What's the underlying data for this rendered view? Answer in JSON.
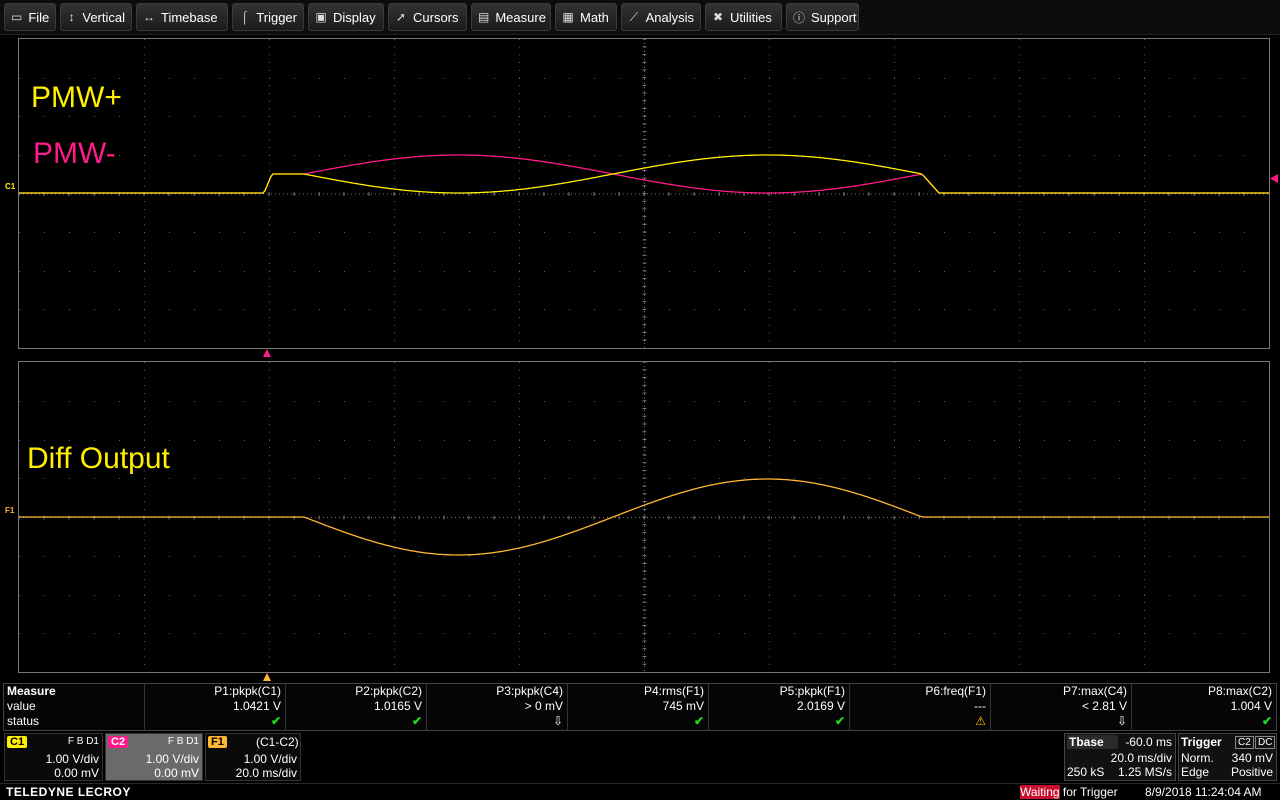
{
  "menu": [
    {
      "label": "File",
      "icon": "file-icon"
    },
    {
      "label": "Vertical",
      "icon": "vertical-arrows-icon"
    },
    {
      "label": "Timebase",
      "icon": "horizontal-arrows-icon"
    },
    {
      "label": "Trigger",
      "icon": "trigger-icon"
    },
    {
      "label": "Display",
      "icon": "display-icon"
    },
    {
      "label": "Cursors",
      "icon": "cursor-icon"
    },
    {
      "label": "Measure",
      "icon": "measure-icon"
    },
    {
      "label": "Math",
      "icon": "calculator-icon"
    },
    {
      "label": "Analysis",
      "icon": "chart-icon"
    },
    {
      "label": "Utilities",
      "icon": "tools-icon"
    },
    {
      "label": "Support",
      "icon": "info-icon"
    }
  ],
  "labels": {
    "pmw_plus": "PMW+",
    "pmw_minus": "PMW-",
    "diff": "Diff Output",
    "c1_marker": "C1",
    "f1_marker": "F1"
  },
  "colors": {
    "c1": "#ffef00",
    "c2": "#ff1a8c",
    "f1": "#ffb833",
    "grid": "#777777"
  },
  "measure": {
    "header": "Measure",
    "row_value": "value",
    "row_status": "status",
    "params": [
      {
        "name": "P1:pkpk(C1)",
        "value": "1.0421 V",
        "status": "✔"
      },
      {
        "name": "P2:pkpk(C2)",
        "value": "1.0165 V",
        "status": "✔"
      },
      {
        "name": "P3:pkpk(C4)",
        "value": "> 0 mV",
        "status": "⇩"
      },
      {
        "name": "P4:rms(F1)",
        "value": "745 mV",
        "status": "✔"
      },
      {
        "name": "P5:pkpk(F1)",
        "value": "2.0169 V",
        "status": "✔"
      },
      {
        "name": "P6:freq(F1)",
        "value": "---",
        "status": "⚠"
      },
      {
        "name": "P7:max(C4)",
        "value": "< 2.81 V",
        "status": "⇩"
      },
      {
        "name": "P8:max(C2)",
        "value": "1.004 V",
        "status": "✔"
      }
    ]
  },
  "channels": {
    "c1": {
      "tag": "C1",
      "fb": "F B D1",
      "vdiv": "1.00 V/div",
      "offset": "0.00 mV"
    },
    "c2": {
      "tag": "C2",
      "fb": "F B D1",
      "vdiv": "1.00 V/div",
      "offset": "0.00 mV"
    },
    "f1": {
      "tag": "F1",
      "title": "(C1-C2)",
      "vdiv": "1.00 V/div",
      "tdiv": "20.0 ms/div"
    }
  },
  "timebase": {
    "label": "Tbase",
    "delay": "-60.0 ms",
    "tdiv": "20.0 ms/div",
    "samples": "250 kS",
    "rate": "1.25 MS/s"
  },
  "trigger": {
    "label": "Trigger",
    "src": "C2",
    "coupling": "DC",
    "mode": "Norm.",
    "level": "340 mV",
    "type": "Edge",
    "slope": "Positive"
  },
  "footer": {
    "brand": "TELEDYNE LECROY",
    "status_hi": "Waiting",
    "status_rest": " for Trigger",
    "datetime": "8/9/2018 11:24:04 AM"
  }
}
